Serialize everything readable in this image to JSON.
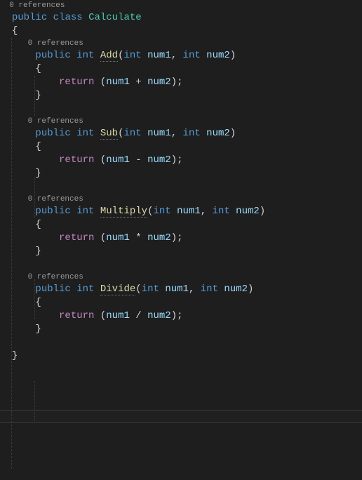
{
  "codelens": {
    "refs": "0 references"
  },
  "class": {
    "modifier": "public",
    "keyword": "class",
    "name": "Calculate"
  },
  "braces": {
    "open": "{",
    "close": "}"
  },
  "kw": {
    "public": "public",
    "int": "int",
    "return": "return"
  },
  "methods": {
    "add": {
      "name": "Add",
      "p1": "num1",
      "p2": "num2",
      "op": "+"
    },
    "sub": {
      "name": "Sub",
      "p1": "num1",
      "p2": "num2",
      "op": "-"
    },
    "multiply": {
      "name": "Multiply",
      "p1": "num1",
      "p2": "num2",
      "op": "*"
    },
    "divide": {
      "name": "Divide",
      "p1": "num1",
      "p2": "num2",
      "op": "/"
    }
  },
  "pad": {
    "base": "  ",
    "i1": "    ",
    "i2": "        "
  },
  "sym": {
    "lparen": "(",
    "rparen": ")",
    "comma": ", ",
    "semi": ";",
    "sp": " "
  }
}
